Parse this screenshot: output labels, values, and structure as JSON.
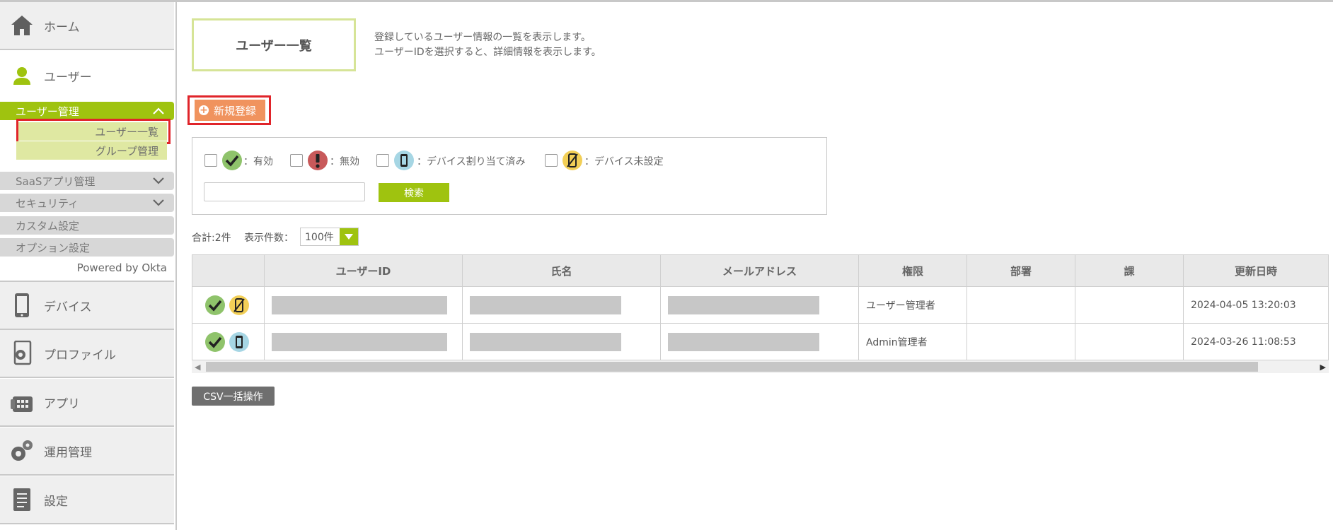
{
  "sidebar": {
    "home": "ホーム",
    "user": "ユーザー",
    "user_mgmt": "ユーザー管理",
    "user_list": "ユーザー一覧",
    "group_mgmt": "グループ管理",
    "saas": "SaaSアプリ管理",
    "security": "セキュリティ",
    "custom": "カスタム設定",
    "option": "オプション設定",
    "powered": "Powered by Okta",
    "device": "デバイス",
    "profile": "プロファイル",
    "app": "アプリ",
    "ops": "運用管理",
    "settings": "設定"
  },
  "header": {
    "title": "ユーザー一覧",
    "desc1": "登録しているユーザー情報の一覧を表示します。",
    "desc2": "ユーザーIDを選択すると、詳細情報を表示します。"
  },
  "toolbar": {
    "new_label": "新規登録"
  },
  "filters": {
    "enabled": "：有効",
    "disabled": "：無効",
    "assigned": "：デバイス割り当て済み",
    "unset": "：デバイス未設定",
    "search_btn": "検索"
  },
  "list": {
    "total": "合計:2件",
    "perpage_label": "表示件数：",
    "perpage_value": "100件",
    "columns": [
      "",
      "ユーザーID",
      "氏名",
      "メールアドレス",
      "権限",
      "部署",
      "課",
      "更新日時"
    ],
    "rows": [
      {
        "role": "ユーザー管理者",
        "dept": "",
        "section": "",
        "updated": "2024-04-05 13:20:03"
      },
      {
        "role": "Admin管理者",
        "dept": "",
        "section": "",
        "updated": "2024-03-26 11:08:53"
      }
    ]
  },
  "csv_label": "CSV一括操作",
  "colors": {
    "accent": "#9fc30f",
    "new_button": "#f0935e",
    "highlight": "#e0242a"
  }
}
